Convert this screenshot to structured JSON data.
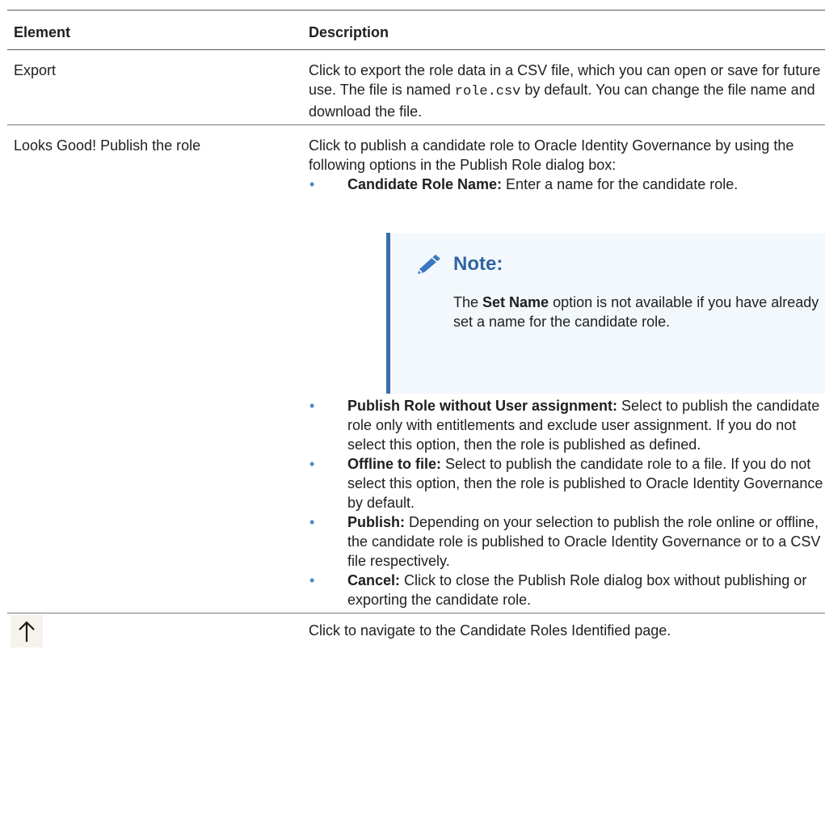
{
  "header": {
    "col1": "Element",
    "col2": "Description"
  },
  "rows": {
    "export": {
      "element": "Export",
      "desc_part1": "Click to export the role data in a CSV file, which you can open or save for future use. The file is named ",
      "code": "role.csv",
      "desc_part2": " by default. You can change the file name and download the file."
    },
    "publish": {
      "element": "Looks Good! Publish the role",
      "intro": "Click to publish a candidate role to Oracle Identity Governance by using the following options in the Publish Role dialog box:",
      "bullets": [
        {
          "label": "Candidate Role Name:",
          "text": " Enter a name for the candidate role."
        },
        {
          "label": "Publish Role without User assignment:",
          "text": " Select to publish the candidate role only with entitlements and exclude user assignment. If you do not select this option, then the role is published as defined."
        },
        {
          "label": "Offline to file:",
          "text": " Select to publish the candidate role to a file. If you do not select this option, then the role is published to Oracle Identity Governance by default."
        },
        {
          "label": "Publish:",
          "text": " Depending on your selection to publish the role online or offline, the candidate role is published to Oracle Identity Governance or to a CSV file respectively."
        },
        {
          "label": "Cancel:",
          "text": " Click to close the Publish Role dialog box without publishing or exporting the candidate role."
        }
      ],
      "note": {
        "title": "Note:",
        "pre": "The ",
        "bold": "Set Name",
        "post": " option is not available if you have already set a name for the candidate role."
      }
    },
    "navigate": {
      "icon": "up-arrow-icon",
      "desc": "Click to navigate to the Candidate Roles Identified page."
    }
  },
  "colors": {
    "bullet": "#4a86c8",
    "note_accent": "#3b6ea8",
    "note_title": "#2f64a3",
    "note_bg": "#f3f8fd"
  }
}
